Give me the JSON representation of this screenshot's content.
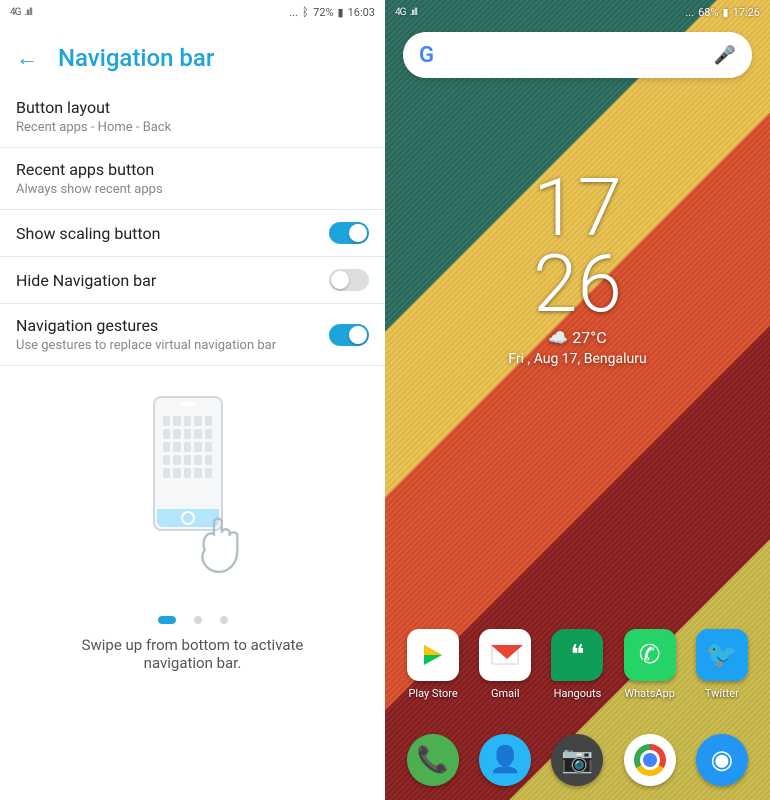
{
  "left": {
    "status": {
      "network": "4G",
      "signal": ".ııll",
      "dots": "...",
      "battery_pct": "72%",
      "time": "16:03"
    },
    "header": {
      "title": "Navigation bar"
    },
    "items": [
      {
        "title": "Button layout",
        "sub": "Recent apps - Home - Back",
        "toggle": null
      },
      {
        "title": "Recent apps button",
        "sub": "Always show recent apps",
        "toggle": null
      },
      {
        "title": "Show scaling button",
        "sub": "",
        "toggle": "on"
      },
      {
        "title": "Hide Navigation bar",
        "sub": "",
        "toggle": "off"
      },
      {
        "title": "Navigation gestures",
        "sub": "Use gestures to replace virtual navigation bar",
        "toggle": "on"
      }
    ],
    "tutorial": {
      "caption": "Swipe up from bottom to activate navigation bar."
    }
  },
  "right": {
    "status": {
      "network": "4G",
      "signal": ".ııll",
      "dots": "...",
      "battery_pct": "68%",
      "time": "17:26"
    },
    "clock": {
      "hh": "17",
      "mm": "26",
      "temp": "27°C",
      "weather_icon": "☁️",
      "date_loc": "Fri , Aug 17, Bengaluru"
    },
    "apps": [
      {
        "name": "Play Store"
      },
      {
        "name": "Gmail"
      },
      {
        "name": "Hangouts"
      },
      {
        "name": "WhatsApp"
      },
      {
        "name": "Twitter"
      }
    ],
    "dock": [
      {
        "name": "Phone"
      },
      {
        "name": "Contacts"
      },
      {
        "name": "Camera"
      },
      {
        "name": "Chrome"
      },
      {
        "name": "Camera2"
      }
    ]
  }
}
